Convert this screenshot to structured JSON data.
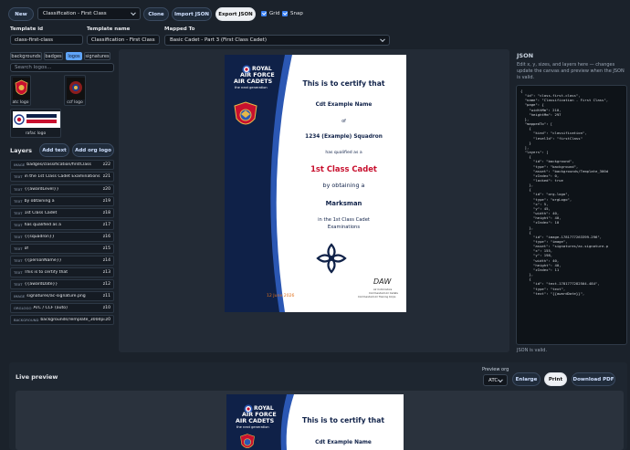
{
  "toolbar": {
    "new_label": "New",
    "template_select": "Classification - First Class",
    "clone_label": "Clone",
    "import_label": "Import JSON",
    "export_label": "Export JSON",
    "grid_label": "Grid",
    "snap_label": "Snap"
  },
  "fields": {
    "template_id_label": "Template id",
    "template_id_value": "class-first-class",
    "template_name_label": "Template name",
    "template_name_value": "Classification - First Class",
    "mapped_to_label": "Mapped To",
    "mapped_to_value": "Basic Cadet - Part 3 (First Class Cadet)"
  },
  "logos": {
    "tabs": [
      "backgrounds",
      "badges",
      "logos",
      "signatures"
    ],
    "active_tab": "logos",
    "search_placeholder": "Search logos...",
    "items": [
      "atc logo",
      "ccf logo",
      "rafac logo"
    ]
  },
  "layers": {
    "title": "Layers",
    "add_text_label": "Add text",
    "add_org_logo_label": "Add org logo",
    "rows": [
      {
        "type": "IMAGE",
        "name": "badges/classification/firstClass",
        "z": "z22"
      },
      {
        "type": "TEXT",
        "name": "in the 1st Class Cadet Examinations",
        "z": "z21"
      },
      {
        "type": "TEXT",
        "name": "{{awardLevel}}",
        "z": "z20"
      },
      {
        "type": "TEXT",
        "name": "by obtaining a",
        "z": "z19"
      },
      {
        "type": "TEXT",
        "name": "1st Class Cadet",
        "z": "z18"
      },
      {
        "type": "TEXT",
        "name": "has qualified as a",
        "z": "z17"
      },
      {
        "type": "TEXT",
        "name": "{{squadron}}",
        "z": "z16"
      },
      {
        "type": "TEXT",
        "name": "of",
        "z": "z15"
      },
      {
        "type": "TEXT",
        "name": "{{personName}}",
        "z": "z14"
      },
      {
        "type": "TEXT",
        "name": "This is to certify that",
        "z": "z13"
      },
      {
        "type": "TEXT",
        "name": "{{awardDate}}",
        "z": "z12"
      },
      {
        "type": "IMAGE",
        "name": "signatures/ac-signature.png",
        "z": "z11"
      },
      {
        "type": "ORGLOGO",
        "name": "ATC / CCF (auto)",
        "z": "z10"
      },
      {
        "type": "BACKGROUND",
        "name": "backgrounds/Template_300dpi...",
        "z": "z0"
      }
    ]
  },
  "certificate": {
    "brand_line1": "ROYAL",
    "brand_line2": "AIR FORCE",
    "brand_line3": "AIR CADETS",
    "brand_line4": "the next generation",
    "heading": "This is to certify that",
    "name": "Cdt Example Name",
    "of": "of",
    "squadron": "1234 (Example) Squadron",
    "qualified": "has qualified as a",
    "award": "1st Class Cadet",
    "by_obtaining": "by obtaining a",
    "level": "Marksman",
    "exams_line1": "in the 1st Class Cadet",
    "exams_line2": "Examinations",
    "date": "12 June 2026",
    "signature": "DAW",
    "sig_title1": "Air Commodore",
    "sig_title2": "Commandant Air Cadets",
    "sig_title3": "Commandant Air Training Corps",
    "accent_red": "#c8102e",
    "accent_navy": "#0f2148"
  },
  "json_panel": {
    "title": "JSON",
    "description": "Edit x, y, sizes, and layers here — changes update the canvas and preview when the JSON is valid.",
    "content": "{\n  \"id\": \"class-first-class\",\n  \"name\": \"Classification - First Class\",\n  \"page\": {\n    \"widthMm\": 210,\n    \"heightMm\": 297\n  },\n  \"mappedTo\": [\n    {\n      \"kind\": \"classification\",\n      \"levelId\": \"firstClass\"\n    }\n  ],\n  \"layers\": [\n    {\n      \"id\": \"background\",\n      \"type\": \"background\",\n      \"asset\": \"backgrounds/Template_300d\n      \"zIndex\": 0,\n      \"locked\": true\n    },\n    {\n      \"id\": \"org-logo\",\n      \"type\": \"orgLogo\",\n      \"x\": 5,\n      \"y\": 45,\n      \"width\": 40,\n      \"height\": 40,\n      \"zIndex\": 10\n    },\n    {\n      \"id\": \"image-1781777263399-296\",\n      \"type\": \"image\",\n      \"asset\": \"signatures/ac-signature.p\n      \"x\": 155,\n      \"y\": 198,\n      \"width\": 40,\n      \"height\": 40,\n      \"zIndex\": 11\n    },\n    {\n      \"id\": \"text-1781777282504-484\",\n      \"type\": \"text\",\n      \"text\": \"{{awardDate}}\",",
    "status": "JSON is valid."
  },
  "preview": {
    "title": "Live preview",
    "org_label": "Preview org",
    "org_value": "ATC",
    "enlarge_label": "Enlarge",
    "print_label": "Print",
    "download_label": "Download PDF"
  }
}
